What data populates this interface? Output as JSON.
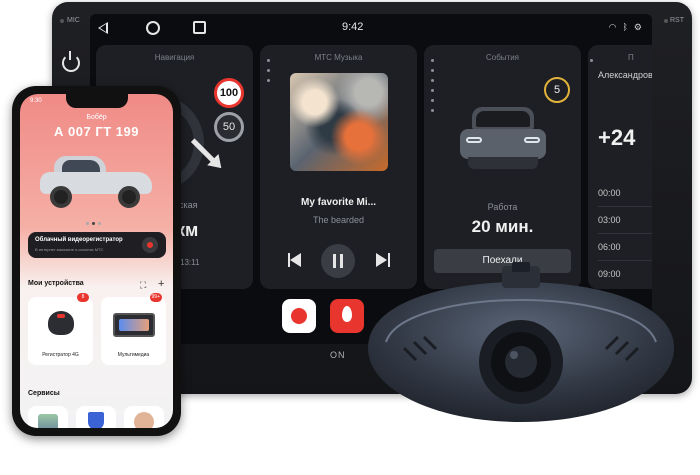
{
  "head_unit": {
    "mic_label": "MIC",
    "rst_label": "RST",
    "clock": "9:42",
    "brand": "ON",
    "navigation": {
      "title": "Навигация",
      "speed_limit": "100",
      "current_speed": "50",
      "street_fragment": "нская",
      "distance_fragment": "км",
      "time_fragment": "13:11"
    },
    "music": {
      "title": "МТС Музыка",
      "song": "My favorite Mi...",
      "artist": "The bearded"
    },
    "events": {
      "title": "События",
      "badge": "5",
      "label": "Работа",
      "value": "20 мин.",
      "go_button": "Поехали"
    },
    "schedule": {
      "title_fragment": "П",
      "name": "Александров",
      "temperature": "+24",
      "times": [
        "00:00",
        "03:00",
        "06:00",
        "09:00"
      ]
    }
  },
  "phone": {
    "status_time": "9:30",
    "owner": "Бобёр",
    "plate": "А 007 ГТ 199",
    "banner_title": "Облачный видеорегистратор",
    "banner_subtitle": "В интернет-магазине и салонах МТС",
    "devices_title": "Мои устройства",
    "devices": [
      {
        "label": "Регистратор 4G",
        "badge": "8"
      },
      {
        "label": "Мультимедиа",
        "badge": "99+"
      }
    ],
    "services_title": "Сервисы"
  },
  "colors": {
    "accent_red": "#e8362f",
    "event_badge": "#e2b33a",
    "card_bg": "#1d1f24"
  }
}
